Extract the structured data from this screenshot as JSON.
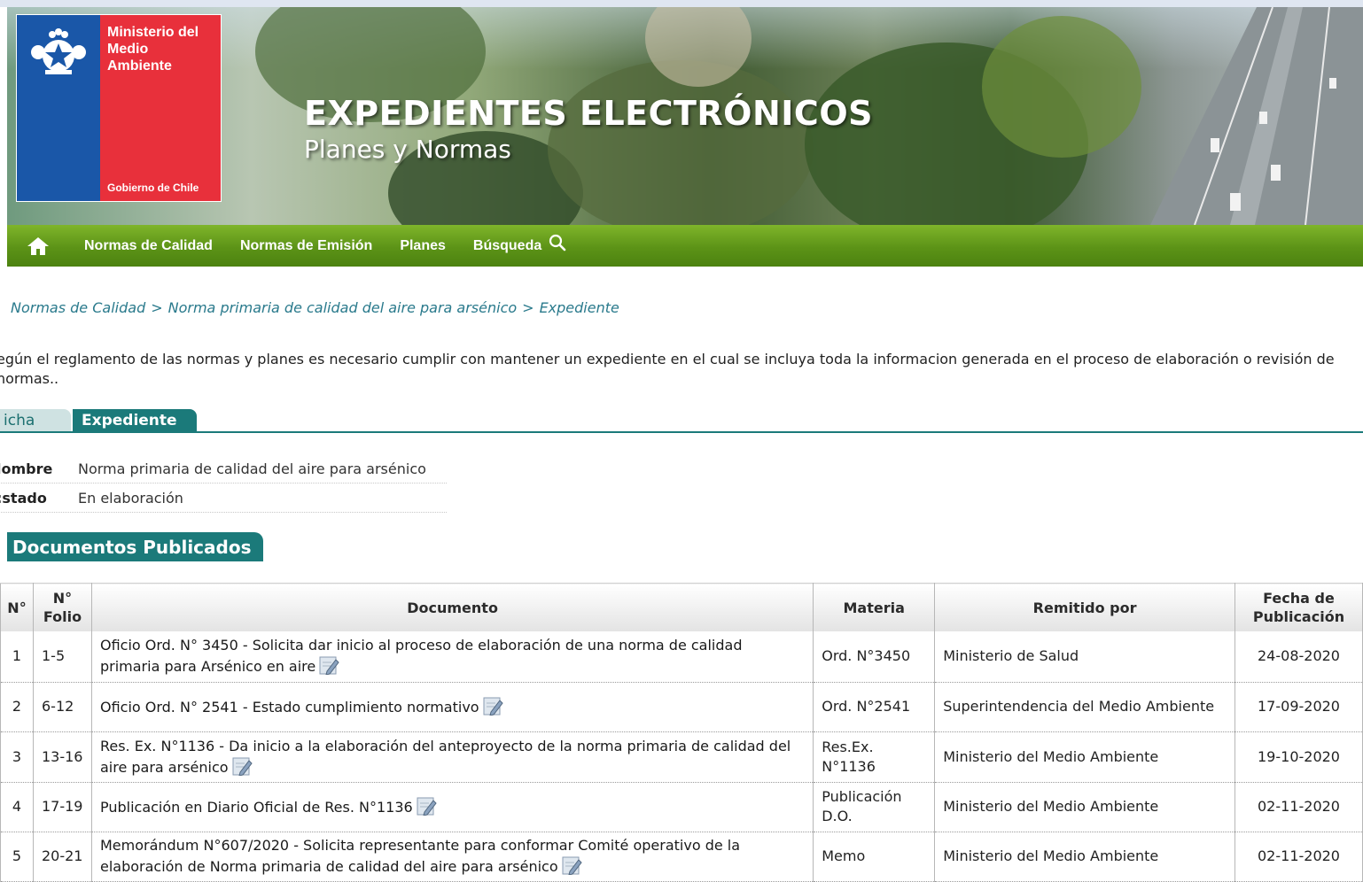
{
  "header": {
    "logo": {
      "ministry": "Ministerio del\nMedio\nAmbiente",
      "government": "Gobierno de Chile"
    },
    "title": "EXPEDIENTES ELECTRÓNICOS",
    "subtitle": "Planes y Normas"
  },
  "nav": {
    "home_icon": "home-icon",
    "items": [
      "Normas de Calidad",
      "Normas de Emisión",
      "Planes",
      "Búsqueda"
    ],
    "search_icon": "search-icon",
    "color": "#5c9317"
  },
  "breadcrumb": {
    "items": [
      "Normas de Calidad",
      "Norma primaria de calidad del aire para arsénico",
      "Expediente"
    ],
    "separator": ">"
  },
  "intro": "egún el reglamento de las normas y planes es necesario cumplir con mantener un expediente en el cual se incluya toda la informacion generada en el proceso de elaboración o revisión de normas..",
  "tabs": {
    "ficha": "icha",
    "expediente": "Expediente",
    "accent": "#1b7a7a"
  },
  "fields": {
    "nombre_label": "lombre",
    "nombre_value": "Norma primaria de calidad del aire para arsénico",
    "estado_label": ":stado",
    "estado_value": "En elaboración"
  },
  "section_title": "Documentos Publicados",
  "table": {
    "headers": [
      "N°",
      "N° Folio",
      "Documento",
      "Materia",
      "Remitido por",
      "Fecha de Publicación"
    ],
    "rows": [
      {
        "n": "1",
        "folio": "1-5",
        "documento": "Oficio Ord. N° 3450 - Solicita dar inicio al proceso de elaboración de una norma de calidad primaria para Arsénico en aire",
        "materia": "Ord. N°3450",
        "remitido": "Ministerio de Salud",
        "fecha": "24-08-2020"
      },
      {
        "n": "2",
        "folio": "6-12",
        "documento": "Oficio Ord. N° 2541 - Estado cumplimiento normativo",
        "materia": "Ord. N°2541",
        "remitido": "Superintendencia del Medio Ambiente",
        "fecha": "17-09-2020"
      },
      {
        "n": "3",
        "folio": "13-16",
        "documento": "Res. Ex. N°1136 - Da inicio a la elaboración del anteproyecto de la norma primaria de calidad del aire para arsénico",
        "materia": "Res.Ex. N°1136",
        "remitido": "Ministerio del Medio Ambiente",
        "fecha": "19-10-2020"
      },
      {
        "n": "4",
        "folio": "17-19",
        "documento": "Publicación en Diario Oficial de Res. N°1136",
        "materia": "Publicación D.O.",
        "remitido": "Ministerio del Medio Ambiente",
        "fecha": "02-11-2020"
      },
      {
        "n": "5",
        "folio": "20-21",
        "documento": "Memorándum N°607/2020 - Solicita representante para conformar Comité operativo de la elaboración de Norma primaria de calidad del aire para arsénico",
        "materia": "Memo",
        "remitido": "Ministerio del Medio Ambiente",
        "fecha": "02-11-2020"
      }
    ]
  }
}
